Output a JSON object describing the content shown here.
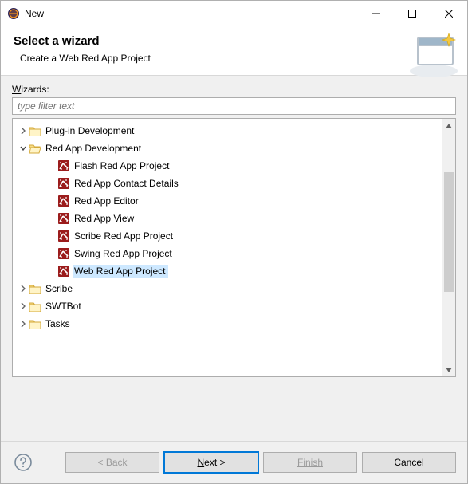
{
  "window": {
    "title": "New"
  },
  "header": {
    "title": "Select a wizard",
    "description": "Create a Web Red App Project"
  },
  "filter": {
    "label_prefix": "W",
    "label_rest": "izards:",
    "placeholder": "type filter text"
  },
  "tree": {
    "items": [
      {
        "kind": "folder",
        "depth": 0,
        "expanded": false,
        "label": "Plug-in Development"
      },
      {
        "kind": "folder",
        "depth": 0,
        "expanded": true,
        "label": "Red App Development"
      },
      {
        "kind": "leaf",
        "depth": 1,
        "label": "Flash Red App Project"
      },
      {
        "kind": "leaf",
        "depth": 1,
        "label": "Red App Contact Details"
      },
      {
        "kind": "leaf",
        "depth": 1,
        "label": "Red App Editor"
      },
      {
        "kind": "leaf",
        "depth": 1,
        "label": "Red App View"
      },
      {
        "kind": "leaf",
        "depth": 1,
        "label": "Scribe Red App Project"
      },
      {
        "kind": "leaf",
        "depth": 1,
        "label": "Swing Red App Project"
      },
      {
        "kind": "leaf",
        "depth": 1,
        "label": "Web Red App Project",
        "selected": true
      },
      {
        "kind": "folder",
        "depth": 0,
        "expanded": false,
        "label": "Scribe"
      },
      {
        "kind": "folder",
        "depth": 0,
        "expanded": false,
        "label": "SWTBot"
      },
      {
        "kind": "folder",
        "depth": 0,
        "expanded": false,
        "label": "Tasks"
      }
    ]
  },
  "buttons": {
    "back": "< Back",
    "next_prefix": "N",
    "next_rest": "ext >",
    "finish": "Finish",
    "cancel": "Cancel"
  }
}
